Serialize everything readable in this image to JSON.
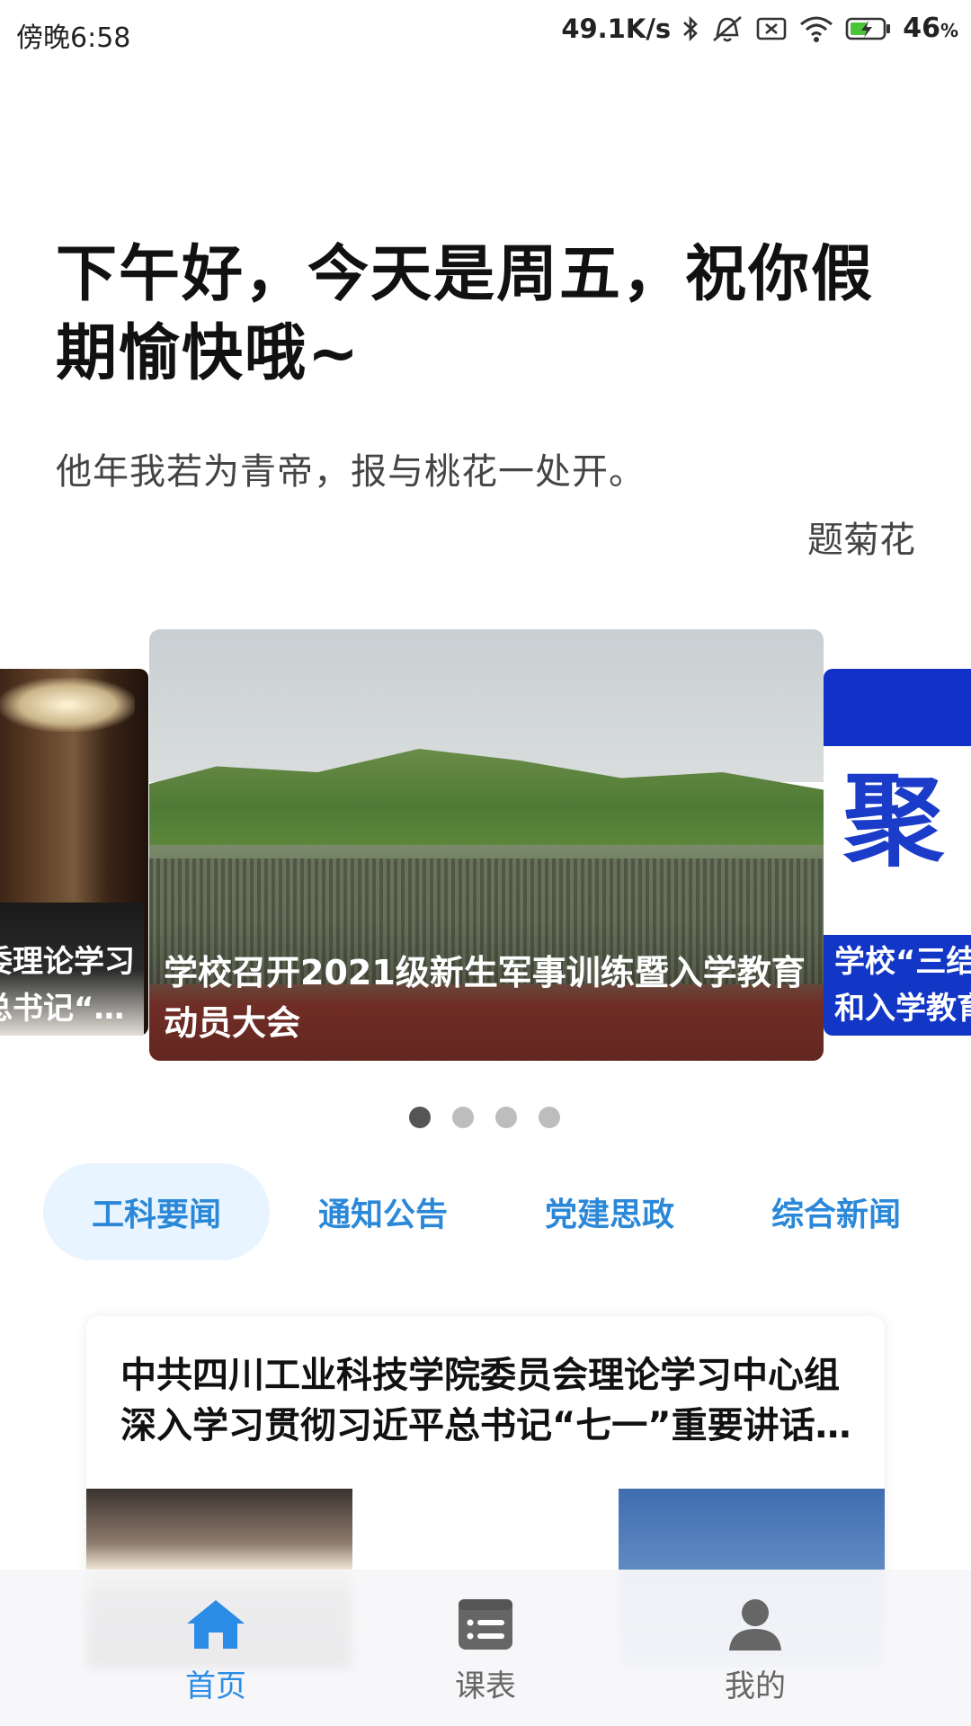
{
  "status_bar": {
    "time": "傍晚6:58",
    "network_speed": "49.1K/s",
    "battery_level": "46",
    "battery_unit": "%",
    "icons": [
      "bluetooth-icon",
      "mute-icon",
      "sim-off-icon",
      "wifi-icon",
      "battery-charging-icon"
    ]
  },
  "greeting": {
    "message": "下午好，今天是周五，祝你假期愉快哦~",
    "poem_line": "他年我若为青帝，报与桃花一处开。",
    "poem_title": "题菊花"
  },
  "carousel": {
    "active_index": 1,
    "slides": [
      {
        "caption": "委理论学习\n总书记“…"
      },
      {
        "caption": "学校召开2021级新生军事训练暨入学教育动员大会"
      },
      {
        "caption": "学校“三结\n和入学教育",
        "heading": "聚"
      }
    ],
    "dot_count": 4
  },
  "tabs": {
    "active": "工科要闻",
    "items": [
      "工科要闻",
      "通知公告",
      "党建思政",
      "综合新闻"
    ]
  },
  "news": {
    "title": "中共四川工业科技学院委员会理论学习中心组深入学习贯彻习近平总书记“七一”重要讲话精神"
  },
  "bottom_nav": {
    "items": [
      {
        "label": "首页",
        "icon": "home-icon",
        "active": true
      },
      {
        "label": "课表",
        "icon": "schedule-icon",
        "active": false
      },
      {
        "label": "我的",
        "icon": "user-icon",
        "active": false
      }
    ],
    "colors": {
      "active": "#2b8ce6",
      "inactive": "#666666"
    }
  }
}
